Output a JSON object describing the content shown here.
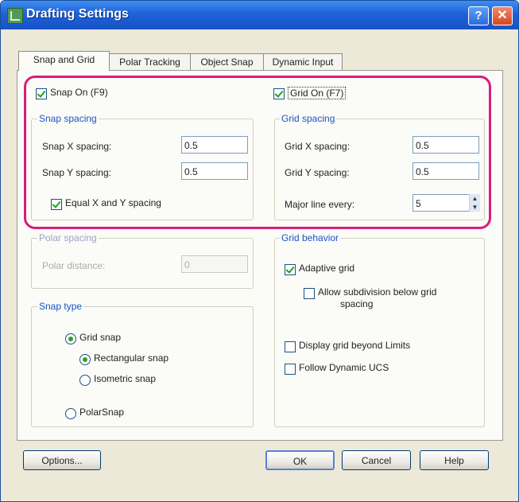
{
  "window": {
    "title": "Drafting Settings"
  },
  "titlebar": {
    "help_label": "?",
    "close_label": "✕"
  },
  "tabs": [
    {
      "label": "Snap and Grid"
    },
    {
      "label": "Polar Tracking"
    },
    {
      "label": "Object Snap"
    },
    {
      "label": "Dynamic Input"
    }
  ],
  "snap": {
    "on_label": "Snap On (F9)",
    "on_checked": true,
    "spacing_title": "Snap spacing",
    "x_label": "Snap X spacing:",
    "x_value": "0.5",
    "y_label": "Snap Y spacing:",
    "y_value": "0.5",
    "equal_label": "Equal X and Y spacing",
    "equal_checked": true
  },
  "grid": {
    "on_label": "Grid On (F7)",
    "on_checked": true,
    "spacing_title": "Grid spacing",
    "x_label": "Grid X spacing:",
    "x_value": "0.5",
    "y_label": "Grid Y spacing:",
    "y_value": "0.5",
    "major_label": "Major line every:",
    "major_value": "5"
  },
  "polar": {
    "title": "Polar spacing",
    "distance_label": "Polar distance:",
    "distance_value": "0"
  },
  "snap_type": {
    "title": "Snap type",
    "grid_snap": "Grid snap",
    "rectangular": "Rectangular snap",
    "isometric": "Isometric snap",
    "polarsnap": "PolarSnap"
  },
  "grid_behavior": {
    "title": "Grid behavior",
    "adaptive": "Adaptive grid",
    "adaptive_checked": true,
    "subdivision": "Allow subdivision below grid spacing",
    "subdivision_line1": "Allow subdivision below grid",
    "subdivision_line2": "spacing",
    "beyond_limits": "Display grid beyond Limits",
    "follow_ucs": "Follow Dynamic UCS"
  },
  "buttons": {
    "options": "Options...",
    "ok": "OK",
    "cancel": "Cancel",
    "help": "Help"
  },
  "colors": {
    "title_bar": "#1f61d7",
    "group_title": "#1a54c8",
    "highlight": "#d81d7b",
    "checkmark": "#21a121"
  }
}
